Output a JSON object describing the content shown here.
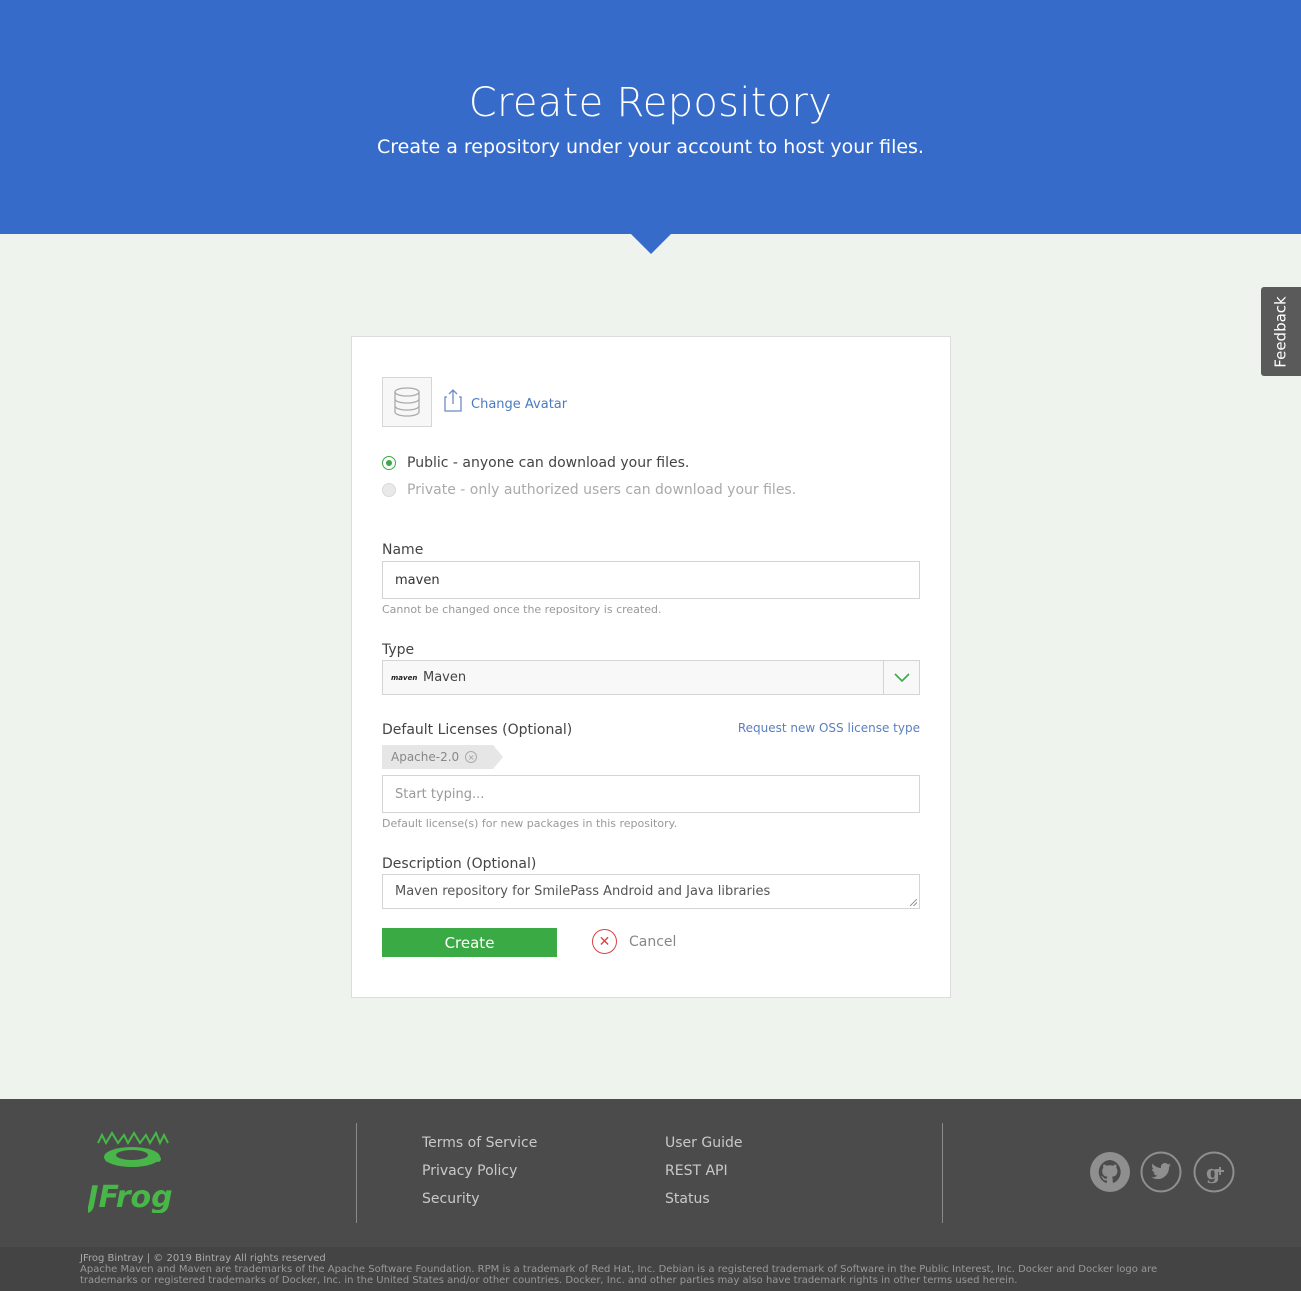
{
  "hero": {
    "title": "Create Repository",
    "subtitle": "Create a repository under your account to host your files."
  },
  "feedback": {
    "label": "Feedback"
  },
  "avatar": {
    "change_label": "Change Avatar"
  },
  "visibility": {
    "public_label": "Public - anyone can download your files.",
    "private_label": "Private - only authorized users can download your files.",
    "selected": "public"
  },
  "name": {
    "label": "Name",
    "value": "maven",
    "hint": "Cannot be changed once the repository is created."
  },
  "type": {
    "label": "Type",
    "value": "Maven",
    "logo_text": "maven"
  },
  "licenses": {
    "label": "Default Licenses (Optional)",
    "request_link": "Request new OSS license type",
    "tags": [
      "Apache-2.0"
    ],
    "placeholder": "Start typing...",
    "hint": "Default license(s) for new packages in this repository."
  },
  "description": {
    "label": "Description (Optional)",
    "value": "Maven repository for SmilePass Android and Java libraries"
  },
  "actions": {
    "create": "Create",
    "cancel": "Cancel"
  },
  "footer": {
    "logo_text": "JFrog",
    "col1": [
      "Terms of Service",
      "Privacy Policy",
      "Security"
    ],
    "col2": [
      "User Guide",
      "REST API",
      "Status"
    ],
    "social": [
      "github-icon",
      "twitter-icon",
      "google-plus-icon"
    ],
    "copyright": "JFrog Bintray | © 2019 Bintray All rights reserved",
    "trademarks": "Apache Maven and Maven are trademarks of the Apache Software Foundation. RPM is a trademark of Red Hat, Inc. Debian is a registered trademark of Software in the Public Interest, Inc. Docker and Docker logo are trademarks or registered trademarks of Docker, Inc. in the United States and/or other countries. Docker, Inc. and other parties may also have trademark rights in other terms used herein."
  },
  "colors": {
    "hero": "#376bc9",
    "primary_button": "#3aaa45",
    "cancel": "#d64545",
    "footer": "#4b4b4b",
    "logo": "#48b649"
  }
}
